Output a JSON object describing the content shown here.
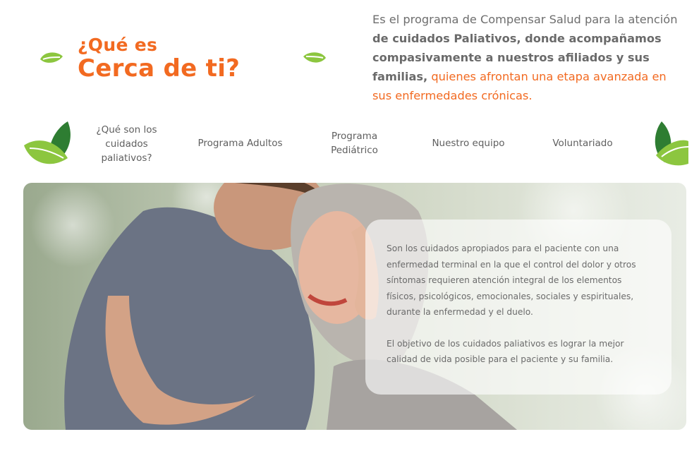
{
  "header": {
    "title_line1": "¿Qué es",
    "title_line2": "Cerca de ti?",
    "intro_part1": "Es el programa de Compensar Salud para la atención ",
    "intro_bold": "de cuidados Paliativos, donde acompañamos compasivamente a nuestros afiliados y sus familias,",
    "intro_accent": " quienes afrontan una etapa avanzada en sus enfermedades crónicas."
  },
  "nav": {
    "items": [
      {
        "label": "¿Qué son los cuidados paliativos?"
      },
      {
        "label": "Programa Adultos"
      },
      {
        "label": "Programa Pediátrico"
      },
      {
        "label": "Nuestro equipo"
      },
      {
        "label": "Voluntariado"
      }
    ]
  },
  "hero": {
    "image_alt": "Hombre abrazando y besando la frente de una mujer sonriente con pañuelo en la cabeza",
    "paragraph1": "Son los cuidados apropiados para el paciente con una enfermedad terminal en la que el control del dolor y otros síntomas requieren atención integral de los elementos físicos, psicológicos, emocionales, sociales y espirituales, durante la enfermedad y el duelo.",
    "paragraph2": "El objetivo de los cuidados paliativos es lograr la mejor calidad de vida posible para el paciente y su familia."
  },
  "colors": {
    "accent": "#f26a21",
    "leaf_light": "#8cc63f",
    "leaf_dark": "#2e7d32",
    "text_gray": "#6e6e6e"
  },
  "icons": [
    "leaf-icon",
    "leaf-cluster-icon"
  ]
}
